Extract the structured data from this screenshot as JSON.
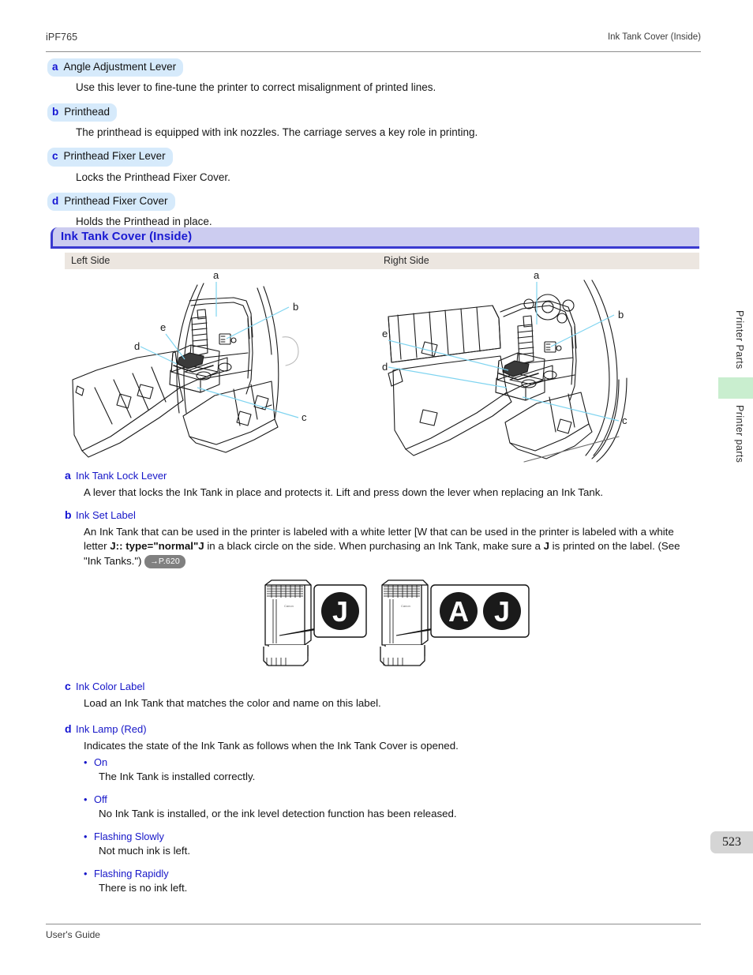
{
  "header": {
    "left": "iPF765",
    "right": "Ink Tank Cover (Inside)"
  },
  "top_items": [
    {
      "letter": "a",
      "title": "Angle Adjustment Lever",
      "desc": "Use this lever to fine-tune the printer to correct misalignment of printed lines."
    },
    {
      "letter": "b",
      "title": "Printhead",
      "desc": "The printhead is equipped with ink nozzles. The carriage serves a key role in printing."
    },
    {
      "letter": "c",
      "title": "Printhead Fixer Lever",
      "desc": "Locks the Printhead Fixer Cover."
    },
    {
      "letter": "d",
      "title": "Printhead Fixer Cover",
      "desc": "Holds the Printhead in place."
    }
  ],
  "section": {
    "title": "Ink Tank Cover (Inside)",
    "band_left": "Left Side",
    "band_right": "Right Side"
  },
  "figures": {
    "left_labels": [
      "a",
      "b",
      "c",
      "d",
      "e"
    ],
    "right_labels": [
      "a",
      "b",
      "c",
      "d",
      "e"
    ]
  },
  "notes": [
    {
      "letter": "a",
      "title": "Ink Tank Lock Lever",
      "body": "A lever that locks the Ink Tank in place and protects it. Lift and press down the lever when replacing an Ink Tank."
    },
    {
      "letter": "b",
      "title": "Ink Set Label",
      "body_part1": "An Ink Tank that can be used in the printer is labeled with a white letter [W that can be used in the printer is labeled with a white letter ",
      "body_bold1": "J:: type=\"normal\"J",
      "body_part2": " in a black circle on the side. When purchasing an Ink Tank, make sure a ",
      "body_bold2": "J",
      "body_part3": " is printed on the label.  (See \"Ink Tanks.\") ",
      "page_ref": "→P.620"
    },
    {
      "letter": "c",
      "title": "Ink Color Label",
      "body": "Load an Ink Tank that matches the color and name on this label."
    },
    {
      "letter": "d",
      "title": "Ink Lamp (Red)",
      "body": "Indicates the state of the Ink Tank as follows when the Ink Tank Cover is opened."
    }
  ],
  "tank_diagram": {
    "tank1_circle": "J",
    "tank2_circle_a": "A",
    "tank2_circle_b": "J"
  },
  "lamp_states": [
    {
      "state": "On",
      "desc": "The Ink Tank is installed correctly."
    },
    {
      "state": "Off",
      "desc": "No Ink Tank is installed, or the ink level detection function has been released."
    },
    {
      "state": "Flashing Slowly",
      "desc": "Not much ink is left."
    },
    {
      "state": "Flashing Rapidly",
      "desc": "There is no ink left."
    }
  ],
  "side_tabs": {
    "tab1": "Printer Parts",
    "tab2": "Printer parts"
  },
  "page_number": "523",
  "footer": {
    "text": "User's Guide"
  },
  "colors": {
    "chip_bg": "#d6eafb",
    "letter_blue": "#1414d2",
    "section_bg": "#ccccf0",
    "section_border": "#3a3ad0",
    "band_bg": "#ece6e0",
    "leader_line": "#7fd4f0",
    "green_tab": "#c9eecf",
    "pref_badge": "#808080",
    "page_badge": "#d5d5d5"
  }
}
